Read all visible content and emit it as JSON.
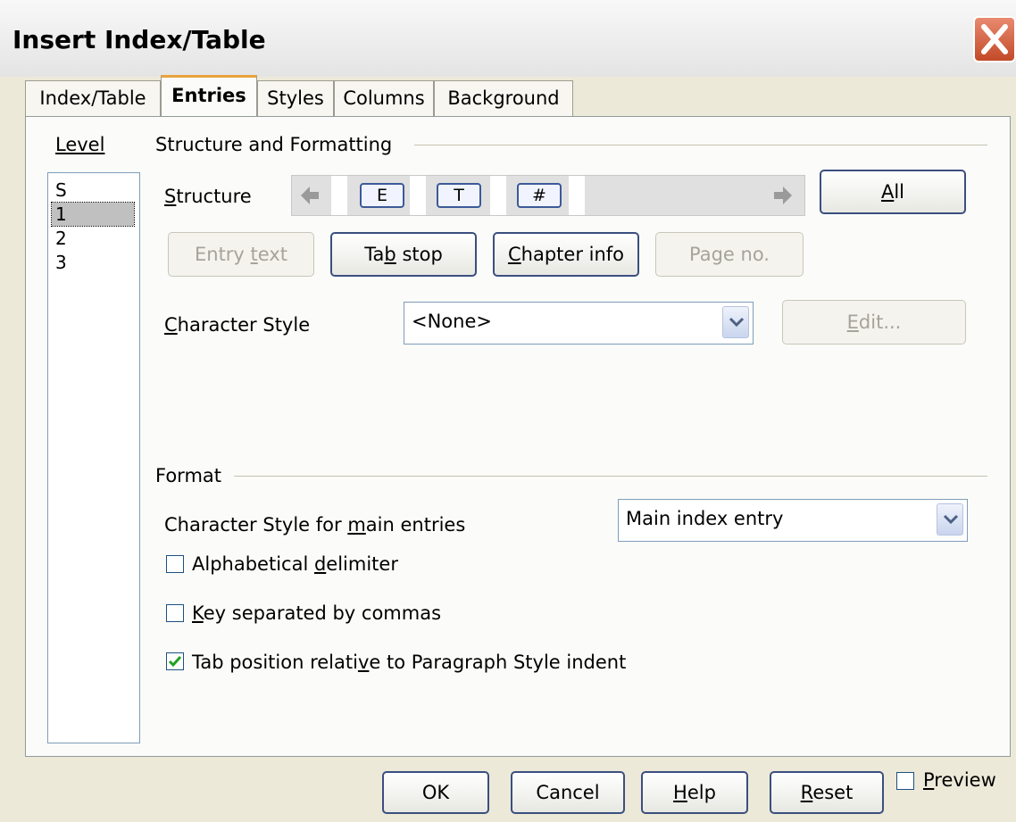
{
  "window": {
    "title": "Insert Index/Table"
  },
  "tabs": [
    {
      "label": "Index/Table",
      "active": false
    },
    {
      "label": "Entries",
      "active": true
    },
    {
      "label": "Styles",
      "active": false
    },
    {
      "label": "Columns",
      "active": false
    },
    {
      "label": "Background",
      "active": false
    }
  ],
  "level": {
    "label": "Level",
    "items": [
      "S",
      "1",
      "2",
      "3"
    ],
    "selected": "1"
  },
  "structure_formatting": {
    "group_label": "Structure and Formatting",
    "structure_label": "Structure",
    "tokens": [
      "E",
      "T",
      "#"
    ],
    "all_button": "All",
    "buttons": {
      "entry_text": "Entry text",
      "tab_stop": "Tab stop",
      "chapter_info": "Chapter info",
      "page_no": "Page no."
    },
    "character_style_label": "Character Style",
    "character_style_value": "<None>",
    "edit_button": "Edit..."
  },
  "format": {
    "group_label": "Format",
    "main_entries_label": "Character Style for main entries",
    "main_entries_value": "Main index entry",
    "alpha_delimiter": {
      "label": "Alphabetical delimiter",
      "checked": false
    },
    "key_separated": {
      "label": "Key separated by commas",
      "checked": false
    },
    "tab_position": {
      "label": "Tab position relative to Paragraph Style indent",
      "checked": true
    }
  },
  "footer": {
    "ok": "OK",
    "cancel": "Cancel",
    "help": "Help",
    "reset": "Reset",
    "preview": {
      "label": "Preview",
      "checked": false
    }
  },
  "colors": {
    "dialog_bg": "#ece9d8",
    "button_border": "#3b4f7f",
    "tab_accent": "#e8a33c",
    "check_green": "#21a121",
    "close_red": "#c24a28"
  }
}
